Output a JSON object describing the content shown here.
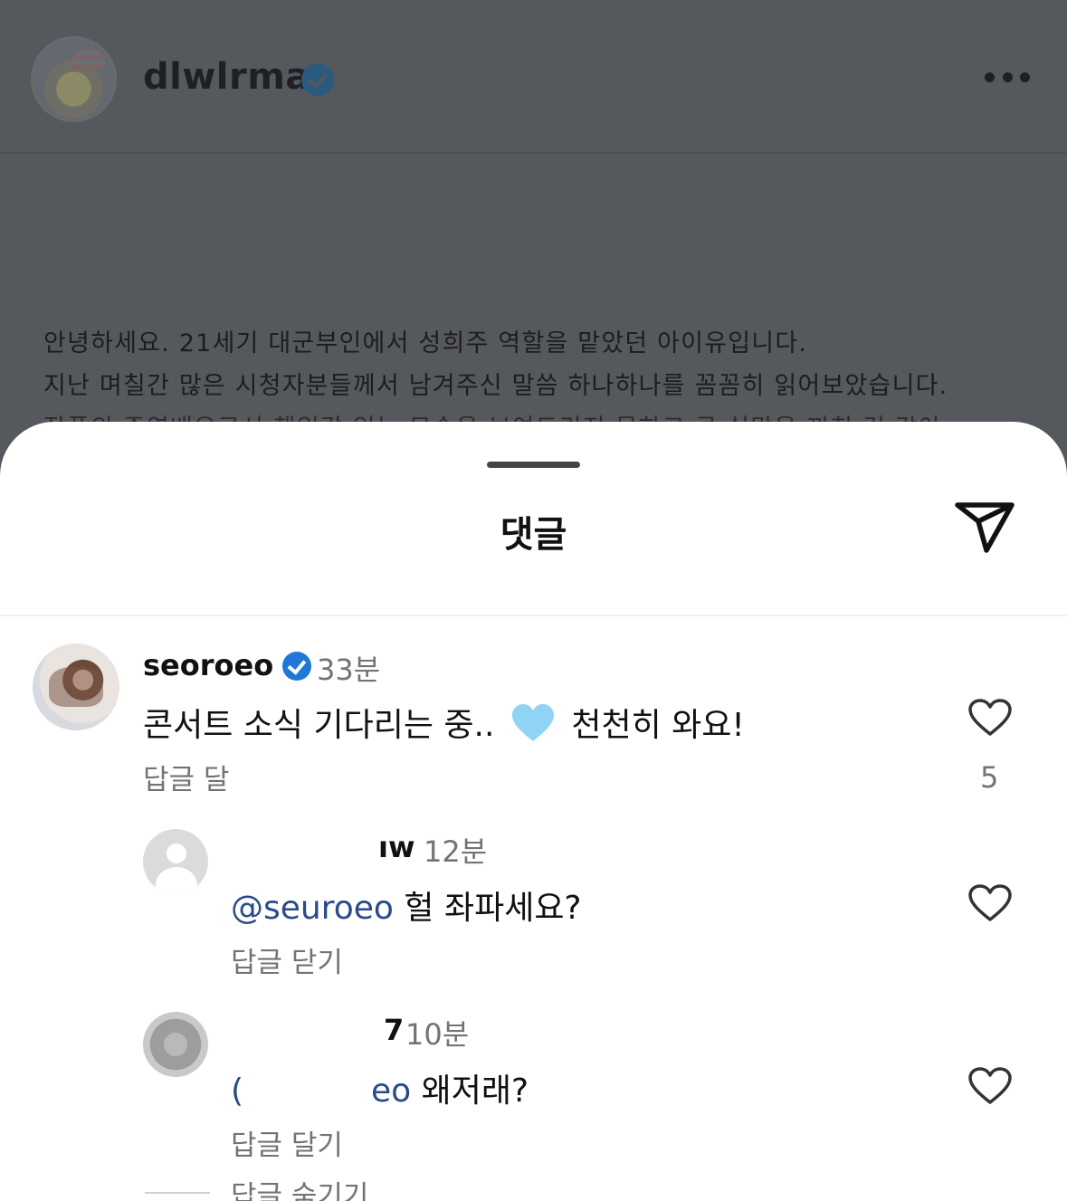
{
  "post": {
    "username": "dlwlrma",
    "caption_lines": [
      "안녕하세요. 21세기 대군부인에서 성희주 역할을 맡았던 아이유입니다.",
      "지난 며칠간 많은 시청자분들께서 남겨주신 말씀 하나하나를 꼼꼼히 읽어보았습니다.",
      "작품의 주연배우로서 책임감 있는 모습을 보여드리지 못하고 큰 실망을 끼친 것 같아"
    ]
  },
  "sheet": {
    "title": "댓글"
  },
  "comments": [
    {
      "username": "seoroeo",
      "time": "33분",
      "text_before": "콘서트 소식 기다리는 중..",
      "text_after": "천천히 와요!",
      "reply_label": "답글 달",
      "likes": "5"
    },
    {
      "username": "ıw",
      "time": "12분",
      "mention": "@seuroeo",
      "text": "헐 좌파세요?",
      "reply_label": "답글 닫기"
    },
    {
      "username": "7",
      "time": "10분",
      "mention_start": "(",
      "mention_end": "eo",
      "text": "왜저래?",
      "reply_label": "답글 달기",
      "hide_replies_label": "답글 숨기기"
    }
  ],
  "colors": {
    "dim_background": "#55585c",
    "verified_blue": "#1f77d6",
    "mention": "#2b4a8a",
    "secondary_text": "#737373",
    "emoji_heart": "#8fd3f5"
  }
}
